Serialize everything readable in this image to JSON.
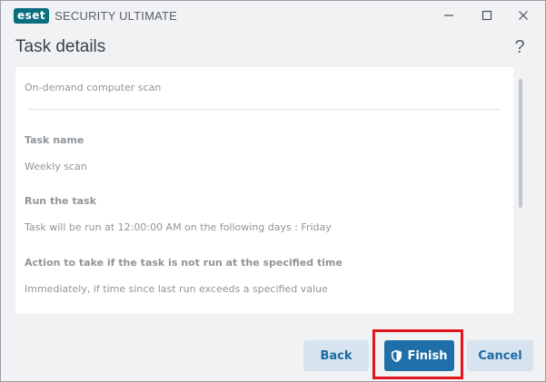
{
  "window": {
    "brand": "eset",
    "app_title": "SECURITY ULTIMATE"
  },
  "header": {
    "title": "Task details",
    "help_glyph": "?"
  },
  "details": {
    "section": "On-demand computer scan",
    "fields": [
      {
        "label": "Task name",
        "value": "Weekly scan"
      },
      {
        "label": "Run the task",
        "value": "Task will be run at 12:00:00 AM on the following days : Friday"
      },
      {
        "label": "Action to take if the task is not run at the specified time",
        "value": "Immediately, if time since last run exceeds a specified value"
      }
    ]
  },
  "buttons": {
    "back": "Back",
    "finish": "Finish",
    "cancel": "Cancel"
  },
  "icons": {
    "minimize": "minimize-icon",
    "maximize": "maximize-icon",
    "close": "close-icon",
    "finish": "shield-icon"
  },
  "colors": {
    "brand": "#0b6e7e",
    "primary": "#1f6fa8",
    "secondary_bg": "#d7e4ef",
    "highlight": "#e3131b"
  }
}
